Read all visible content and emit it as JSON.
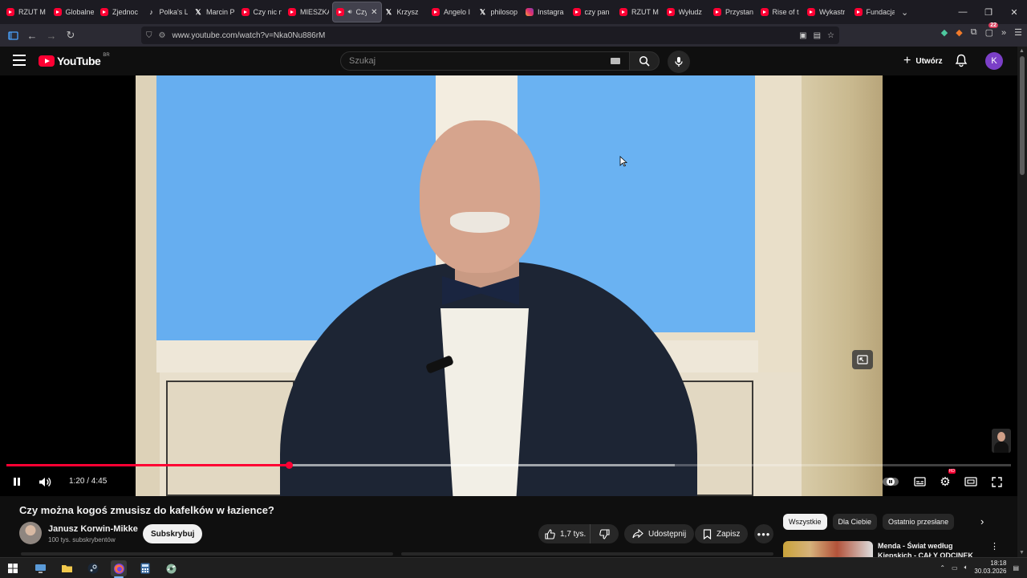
{
  "browser": {
    "tabs": [
      {
        "label": "RZUT M",
        "icon": "youtube-icon"
      },
      {
        "label": "Globalne",
        "icon": "youtube-icon"
      },
      {
        "label": "Zjednoc",
        "icon": "youtube-icon"
      },
      {
        "label": "Polka's L",
        "icon": "tiktok-icon"
      },
      {
        "label": "Marcin P",
        "icon": "x-icon"
      },
      {
        "label": "Czy nic n",
        "icon": "youtube-icon"
      },
      {
        "label": "MIESZKA",
        "icon": "youtube-icon"
      },
      {
        "label": "Czy",
        "icon": "youtube-icon",
        "active": true
      },
      {
        "label": "Krzysz",
        "icon": "x-icon"
      },
      {
        "label": "Angelo I",
        "icon": "youtube-icon"
      },
      {
        "label": "philosop",
        "icon": "x-icon"
      },
      {
        "label": "Instagra",
        "icon": "instagram-icon"
      },
      {
        "label": "czy pan",
        "icon": "youtube-icon"
      },
      {
        "label": "RZUT M",
        "icon": "youtube-icon"
      },
      {
        "label": "Wyłudz",
        "icon": "youtube-icon"
      },
      {
        "label": "Przystan",
        "icon": "youtube-icon"
      },
      {
        "label": "Rise of t",
        "icon": "youtube-icon"
      },
      {
        "label": "Wykastr",
        "icon": "youtube-icon"
      },
      {
        "label": "Fundacja",
        "icon": "youtube-icon"
      }
    ],
    "url": "www.youtube.com/watch?v=Nka0Nu886rM",
    "extension_badge": "22"
  },
  "youtube": {
    "logo_text": "YouTube",
    "region": "BR",
    "search_placeholder": "Szukaj",
    "create_label": "Utwórz",
    "avatar_letter": "K",
    "accent": "#ff0033"
  },
  "player": {
    "time_current": "1:20",
    "time_total": "4:45",
    "time_display": "1:20 / 4:45",
    "progress_fraction": 0.281,
    "buffered_fraction": 0.665,
    "hd_badge": "HD"
  },
  "video": {
    "title": "Czy można kogoś zmusisz do kafelków w łazience?",
    "channel_name": "Janusz Korwin-Mikke",
    "subscribers": "100 tys. subskrybentów",
    "subscribe_label": "Subskrybuj",
    "likes": "1,7 tys.",
    "share_label": "Udostępnij",
    "save_label": "Zapisz"
  },
  "sidebar": {
    "chips": [
      "Wszystkie",
      "Dla Ciebie",
      "Ostatnio przesłane"
    ],
    "recommendation_title": "Menda - Świat według Kiepskich - CAŁY ODCINEK"
  },
  "taskbar": {
    "time": "18:18",
    "date": "30.03.2026"
  }
}
